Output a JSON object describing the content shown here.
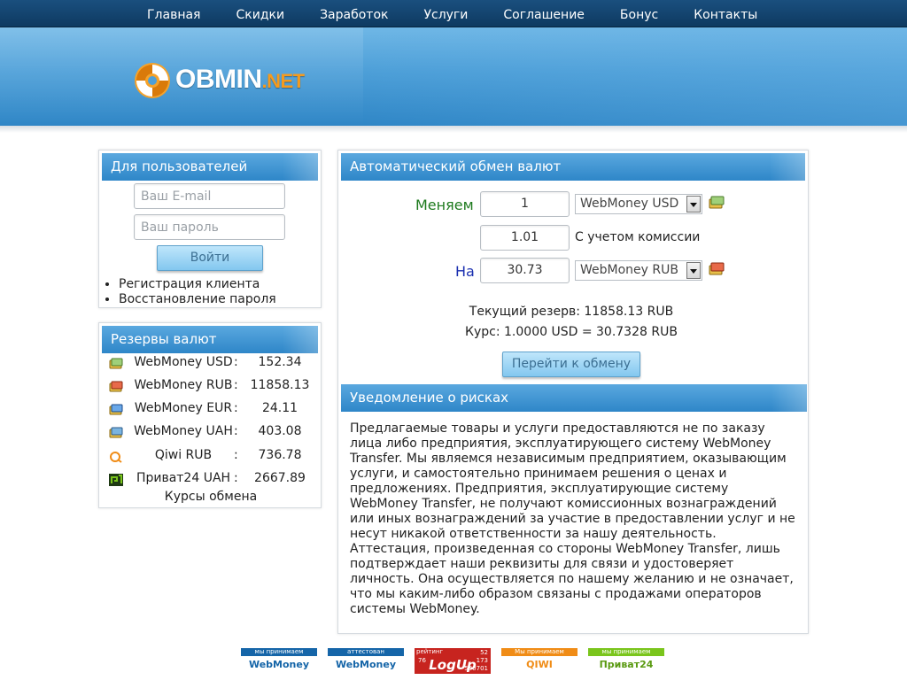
{
  "nav": [
    "Главная",
    "Скидки",
    "Заработок",
    "Услуги",
    "Соглашение",
    "Бонус",
    "Контакты"
  ],
  "logo": {
    "main": "OBMIN",
    "suffix": ".NET"
  },
  "colors": {
    "accent": "#2e86c8",
    "logo_orange": "#f59a1d",
    "green_label": "#1e7a1e",
    "blue_label": "#1a2fb0"
  },
  "login": {
    "title": "Для пользователей",
    "email_placeholder": "Ваш E-mail",
    "password_placeholder": "Ваш пароль",
    "submit": "Войти",
    "links": [
      "Регистрация клиента",
      "Восстановление пароля"
    ]
  },
  "reserves": {
    "title": "Резервы валют",
    "rows": [
      {
        "icon": "webmoney-usd-icon",
        "name": "WebMoney USD",
        "value": "152.34"
      },
      {
        "icon": "webmoney-rub-icon",
        "name": "WebMoney RUB",
        "value": "11858.13"
      },
      {
        "icon": "webmoney-eur-icon",
        "name": "WebMoney EUR",
        "value": "24.11"
      },
      {
        "icon": "webmoney-uah-icon",
        "name": "WebMoney UAH",
        "value": "403.08"
      },
      {
        "icon": "qiwi-icon",
        "name": "Qiwi RUB",
        "value": "736.78"
      },
      {
        "icon": "privat24-icon",
        "name": "Приват24 UAH",
        "value": "2667.89"
      }
    ],
    "separator": ":",
    "rates_link": "Курсы обмена"
  },
  "exchange": {
    "title": "Автоматический обмен валют",
    "give_label": "Меняем",
    "give_amount": "1",
    "give_currency": "WebMoney USD",
    "commission_amount": "1.01",
    "commission_label": "С учетом комиссии",
    "get_label": "На",
    "get_amount": "30.73",
    "get_currency": "WebMoney RUB",
    "reserve_text": "Текущий резерв: 11858.13 RUB",
    "rate_text": "Курс: 1.0000 USD = 30.7328 RUB",
    "submit": "Перейти к обмену"
  },
  "risk": {
    "title": "Уведомление о рисках",
    "text": "Предлагаемые товары и услуги предоставляются не по заказу лица либо предприятия, эксплуатирующего систему WebMoney Transfer. Мы являемся независимым предприятием, оказывающим услуги, и самостоятельно принимаем решения о ценах и предложениях. Предприятия, эксплуатирующие систему WebMoney Transfer, не получают комиссионных вознаграждений или иных вознаграждений за участие в предоставлении услуг и не несут никакой ответственности за нашу деятельность. Аттестация, произведенная со стороны WebMoney Transfer, лишь подтверждает наши реквизиты для связи и удостоверяет личность. Она осуществляется по нашему желанию и не означает, что мы каким-либо образом связаны с продажами операторов системы WebMoney."
  },
  "footer_badges": [
    {
      "top": "мы принимаем",
      "bottom": "WebMoney",
      "color": "#1565a8"
    },
    {
      "top": "аттестован",
      "bottom": "WebMoney",
      "color": "#1565a8"
    },
    {
      "top": "рейтинг",
      "bottom": "LogUp",
      "numbers": [
        "76",
        "52",
        "173",
        "500701"
      ],
      "color": "#c7241f"
    },
    {
      "top": "Мы принимаем",
      "bottom": "QIWI",
      "color": "#f08c16"
    },
    {
      "top": "мы принимаем",
      "bottom": "Приват24",
      "color": "#7ac51c"
    }
  ]
}
